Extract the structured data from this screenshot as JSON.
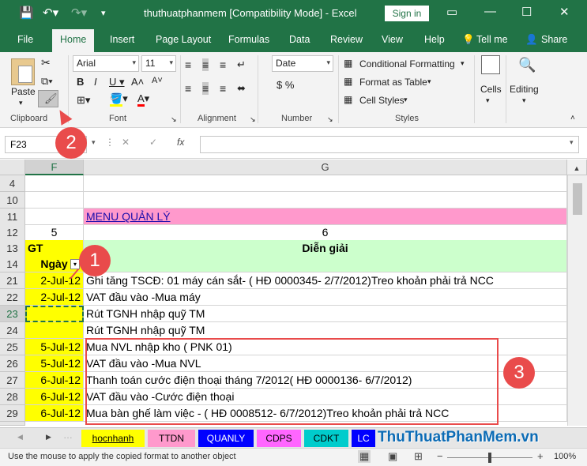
{
  "titlebar": {
    "title": "thuthuatphanmem  [Compatibility Mode]  -  Excel",
    "signin": "Sign in"
  },
  "tabs": [
    "File",
    "Home",
    "Insert",
    "Page Layout",
    "Formulas",
    "Data",
    "Review",
    "View",
    "Help",
    "Tell me",
    "Share"
  ],
  "ribbon": {
    "paste_label": "Paste",
    "clipboard_label": "Clipboard",
    "font_name": "Arial",
    "font_size": "11",
    "font_label": "Font",
    "alignment_label": "Alignment",
    "number_format": "Date",
    "number_label": "Number",
    "conditional_formatting": "Conditional Formatting",
    "format_as_table": "Format as Table",
    "cell_styles": "Cell Styles",
    "styles_label": "Styles",
    "cells_label": "Cells",
    "editing_label": "Editing"
  },
  "formula_bar": {
    "name_box": "F23",
    "fx": "fx"
  },
  "columns": {
    "f": "F",
    "g": "G"
  },
  "rows": [
    {
      "num": "4",
      "f": "",
      "g": ""
    },
    {
      "num": "10",
      "f": "",
      "g": ""
    },
    {
      "num": "11",
      "f": "",
      "g": "MENU QUẢN LÝ"
    },
    {
      "num": "12",
      "f": "5",
      "g": "6"
    },
    {
      "num": "13",
      "f": "GT",
      "g": "Diễn giải"
    },
    {
      "num": "14",
      "f": "Ngày",
      "g": ""
    },
    {
      "num": "21",
      "f": "2-Jul-12",
      "g": "Ghi tăng TSCĐ: 01 máy cán sắt- ( HĐ 0000345- 2/7/2012)Treo khoản phải trả NCC"
    },
    {
      "num": "22",
      "f": "2-Jul-12",
      "g": "VAT đầu vào -Mua máy"
    },
    {
      "num": "23",
      "f": "",
      "g": "Rút TGNH nhập quỹ TM"
    },
    {
      "num": "24",
      "f": "",
      "g": "Rút TGNH nhập quỹ TM"
    },
    {
      "num": "25",
      "f": "5-Jul-12",
      "g": "Mua NVL nhập kho ( PNK 01)"
    },
    {
      "num": "26",
      "f": "5-Jul-12",
      "g": "VAT đầu vào -Mua NVL"
    },
    {
      "num": "27",
      "f": "6-Jul-12",
      "g": "Thanh toán cước điện thoại tháng 7/2012( HĐ 0000136- 6/7/2012)"
    },
    {
      "num": "28",
      "f": "6-Jul-12",
      "g": "VAT đầu vào -Cước điện thoại"
    },
    {
      "num": "29",
      "f": "6-Jul-12",
      "g": "Mua bàn ghế làm việc - ( HĐ 0008512- 6/7/2012)Treo khoản phải trả NCC"
    }
  ],
  "sheets": [
    "hocnhanh",
    "TTDN",
    "QUANLY",
    "CDPS",
    "CDKT",
    "LC"
  ],
  "watermark": "ThuThuatPhanMem.vn",
  "status": {
    "message": "Use the mouse to apply the copied format to another object",
    "zoom": "100%"
  },
  "badges": [
    "1",
    "2",
    "3"
  ],
  "colors": {
    "excel_green": "#217346",
    "yellow": "#ffff00",
    "pink": "#ff99cc",
    "light_green": "#ccffcc",
    "badge_red": "#e94b4b"
  }
}
